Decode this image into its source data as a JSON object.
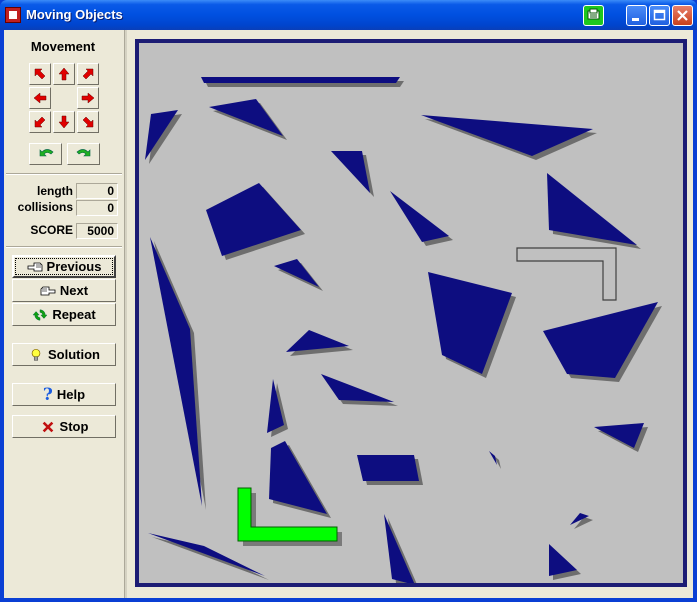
{
  "window": {
    "title": "Moving Objects",
    "icons": {
      "app": "app-icon",
      "print": "print-icon",
      "minimize": "minimize-icon",
      "maximize": "maximize-icon",
      "close": "close-icon"
    }
  },
  "sidebar": {
    "movement_title": "Movement",
    "move_buttons": [
      "up-left",
      "up",
      "up-right",
      "left",
      "right",
      "down-left",
      "down",
      "down-right"
    ],
    "rotate_buttons": [
      "rotate-left",
      "rotate-right"
    ],
    "stats": {
      "length_label": "length",
      "length_value": "0",
      "collisions_label": "collisions",
      "collisions_value": "0",
      "score_label": "SCORE",
      "score_value": "5000"
    },
    "buttons": {
      "previous": "Previous",
      "next": "Next",
      "repeat": "Repeat",
      "solution": "Solution",
      "help": "Help",
      "stop": "Stop"
    }
  },
  "colors": {
    "obstacle": "#0d0d80",
    "shadow": "#6e6e6e",
    "mover": "#00ff00",
    "board_bg": "#c0c0c0",
    "frame": "#1c1c74"
  }
}
